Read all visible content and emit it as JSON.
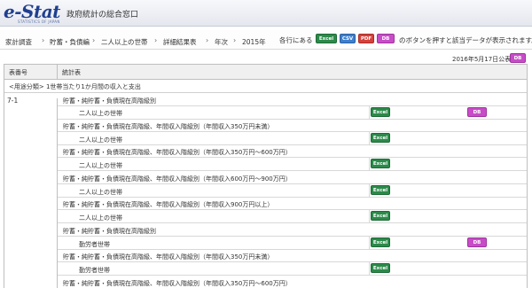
{
  "header": {
    "logo_text": "e-Stat",
    "logo_sub": "STATISTICS OF JAPAN",
    "site_title": "政府統計の総合窓口"
  },
  "breadcrumb": [
    "家計調査",
    "貯蓄・負債編",
    "二人以上の世帯",
    "詳細結果表",
    "年次",
    "2015年"
  ],
  "help": {
    "prefix": "各行にある",
    "suffix": "のボタンを押すと該当データが表示されます。",
    "buttons": [
      "Excel",
      "CSV",
      "PDF",
      "DB"
    ]
  },
  "published": "2016年5月17日公表",
  "table": {
    "col_id": "表番号",
    "col_name": "統計表",
    "group": "<用途分類> 1世帯当たり1か月間の収入と支出",
    "table_id": "7-1",
    "rows": [
      {
        "title": "貯蓄・純貯蓄・負債現在高階級別",
        "sub": "二人以上の世帯",
        "excel": "Excel",
        "db": "DB"
      },
      {
        "title": "貯蓄・純貯蓄・負債現在高階級、年間収入階級別（年間収入350万円未満）",
        "sub": "二人以上の世帯",
        "excel": "Excel",
        "db": ""
      },
      {
        "title": "貯蓄・純貯蓄・負債現在高階級、年間収入階級別（年間収入350万円～600万円）",
        "sub": "二人以上の世帯",
        "excel": "Excel",
        "db": ""
      },
      {
        "title": "貯蓄・純貯蓄・負債現在高階級、年間収入階級別（年間収入600万円～900万円）",
        "sub": "二人以上の世帯",
        "excel": "Excel",
        "db": ""
      },
      {
        "title": "貯蓄・純貯蓄・負債現在高階級、年間収入階級別（年間収入900万円以上）",
        "sub": "二人以上の世帯",
        "excel": "Excel",
        "db": ""
      },
      {
        "title": "貯蓄・純貯蓄・負債現在高階級別",
        "sub": "勤労者世帯",
        "excel": "Excel",
        "db": "DB"
      },
      {
        "title": "貯蓄・純貯蓄・負債現在高階級、年間収入階級別（年間収入350万円未満）",
        "sub": "勤労者世帯",
        "excel": "Excel",
        "db": ""
      },
      {
        "title": "貯蓄・純貯蓄・負債現在高階級、年間収入階級別（年間収入350万円～600万円）",
        "sub": "",
        "excel": "",
        "db": ""
      }
    ]
  },
  "colors": {
    "excel": "#2c8a4a",
    "csv": "#3c7fd0",
    "pdf": "#d6403a",
    "db": "#c84cc8"
  }
}
